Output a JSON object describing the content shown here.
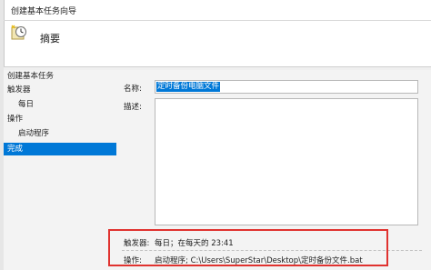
{
  "window": {
    "title": "创建基本任务向导"
  },
  "header": {
    "heading": "摘要",
    "icon": "clock-task-icon"
  },
  "nav": {
    "items": [
      {
        "label": "创建基本任务",
        "level": 1,
        "selected": false
      },
      {
        "label": "触发器",
        "level": 1,
        "selected": false
      },
      {
        "label": "每日",
        "level": 2,
        "selected": false
      },
      {
        "label": "操作",
        "level": 1,
        "selected": false
      },
      {
        "label": "启动程序",
        "level": 2,
        "selected": false
      },
      {
        "label": "完成",
        "level": 1,
        "selected": true
      }
    ]
  },
  "form": {
    "name_label": "名称:",
    "name_value": "定时备份电脑文件",
    "desc_label": "描述:",
    "desc_value": ""
  },
  "summary": {
    "trigger_label": "触发器:",
    "trigger_value": "每日；在每天的 23:41",
    "action_label": "操作:",
    "action_value": "启动程序; C:\\Users\\SuperStar\\Desktop\\定时备份文件.bat"
  },
  "colors": {
    "selection": "#0078d7",
    "highlight_box": "#e0322f"
  }
}
